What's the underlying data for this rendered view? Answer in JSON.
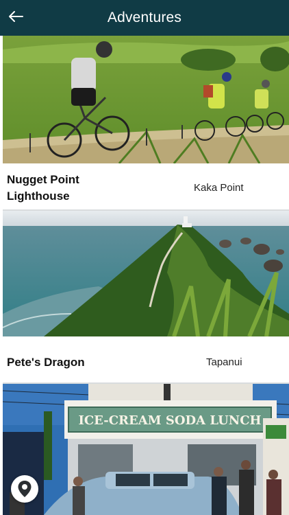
{
  "header": {
    "title": "Adventures",
    "back_icon": "arrow-left-icon"
  },
  "items": [
    {
      "name_line1": "Nugget Point",
      "name_line2": "Lighthouse",
      "location": "Kaka Point"
    },
    {
      "name": "Pete's Dragon",
      "location": "Tapanui"
    }
  ],
  "third_image": {
    "sign_text": "ICE-CREAM SODA LUNCH"
  },
  "fab": {
    "icon": "map-pin-icon"
  },
  "colors": {
    "header_bg": "#103b45",
    "separator": "#d9dcde"
  }
}
